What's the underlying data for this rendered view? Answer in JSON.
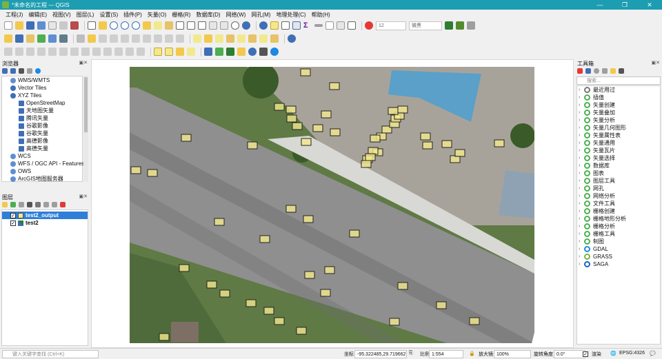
{
  "window": {
    "title": "*未命名的工程 — QGIS"
  },
  "menu": [
    "工程(J)",
    "编辑(E)",
    "视图(V)",
    "图层(L)",
    "设置(S)",
    "插件(P)",
    "矢量(O)",
    "栅格(R)",
    "数据库(D)",
    "网络(W)",
    "网孔(M)",
    "地理处理(C)",
    "帮助(H)"
  ],
  "toolbar": {
    "font_size": "12",
    "font_name": "微黑"
  },
  "browser": {
    "title": "浏览器",
    "items": [
      {
        "label": "WMS/WMTS",
        "indent": 1
      },
      {
        "label": "Vector Tiles",
        "indent": 1
      },
      {
        "label": "XYZ Tiles",
        "indent": 1
      },
      {
        "label": "OpenStreetMap",
        "indent": 2
      },
      {
        "label": "天地图矢量",
        "indent": 2
      },
      {
        "label": "腾讯矢量",
        "indent": 2
      },
      {
        "label": "谷歌影像",
        "indent": 2
      },
      {
        "label": "谷歌矢量",
        "indent": 2
      },
      {
        "label": "高德影像",
        "indent": 2
      },
      {
        "label": "高德矢量",
        "indent": 2
      },
      {
        "label": "WCS",
        "indent": 1
      },
      {
        "label": "WFS / OGC API - Features",
        "indent": 1
      },
      {
        "label": "OWS",
        "indent": 1
      },
      {
        "label": "ArcGIS地图服务器",
        "indent": 1
      }
    ]
  },
  "layers": {
    "title": "图层",
    "items": [
      {
        "name": "test2_output",
        "checked": true,
        "selected": true
      },
      {
        "name": "test2",
        "checked": true,
        "selected": false
      }
    ]
  },
  "toolbox": {
    "title": "工具箱",
    "search_placeholder": "搜索...",
    "items": [
      "最近用过",
      "插值",
      "矢量创建",
      "矢量叠加",
      "矢量分析",
      "矢量几何图形",
      "矢量属性表",
      "矢量通用",
      "矢量瓦片",
      "矢量选择",
      "数据库",
      "图表",
      "图层工具",
      "网孔",
      "网络分析",
      "文件工具",
      "栅格创建",
      "栅格地形分析",
      "栅格分析",
      "栅格工具",
      "制图",
      "GDAL",
      "GRASS",
      "SAGA"
    ]
  },
  "statusbar": {
    "locator_placeholder": "键入关键字查找 (Ctrl+K)",
    "coord_label": "坐标",
    "coord_value": "-95.322485,29.719662",
    "scale_label": "比例",
    "scale_value": "1:554",
    "magnifier_label": "放大镜",
    "magnifier_value": "100%",
    "rotation_label": "旋转角度",
    "rotation_value": "0.0°",
    "render_label": "渲染",
    "crs": "EPSG:4326"
  },
  "colors": {
    "titlebar": "#1d9db1",
    "selection": "#2f7fd8",
    "vehicle_box_fill": "#f2e98c",
    "vehicle_box_stroke": "#222222"
  }
}
